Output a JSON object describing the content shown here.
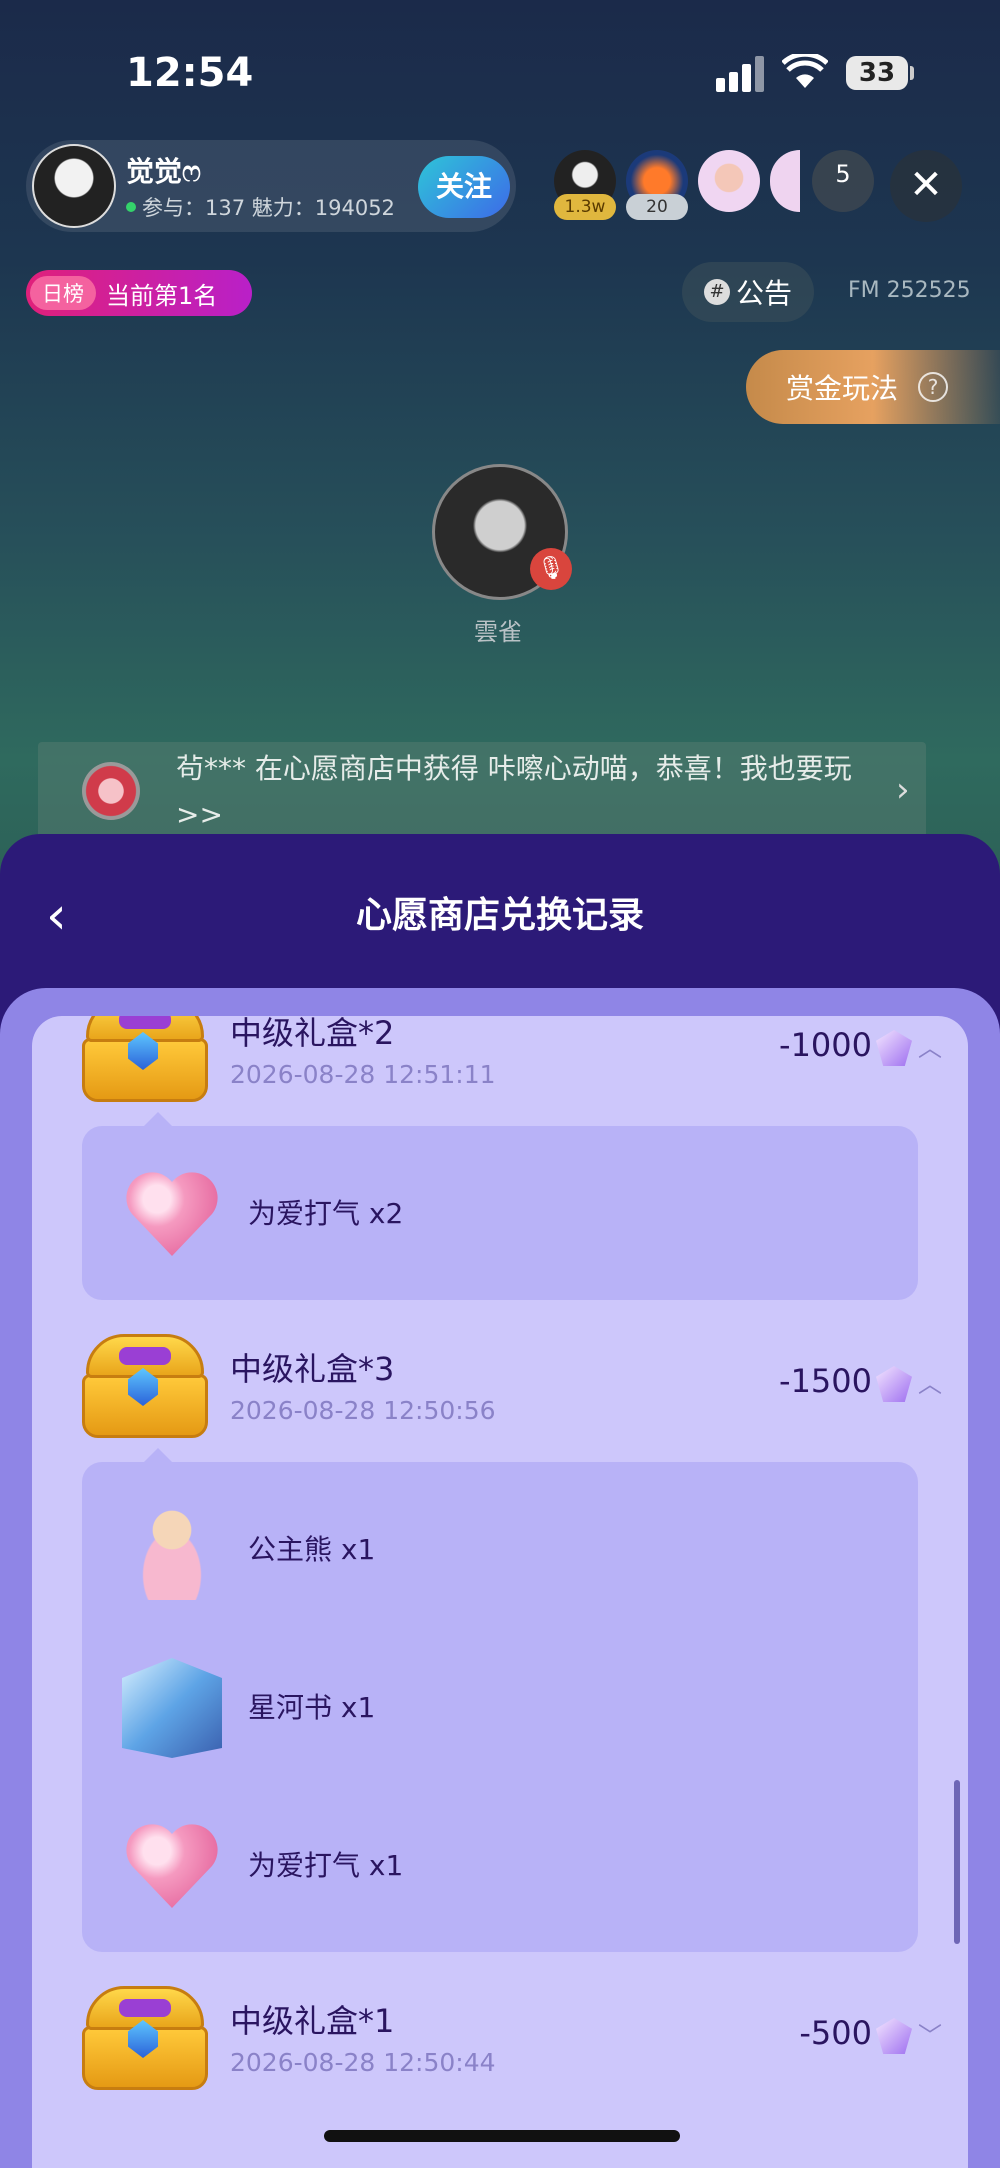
{
  "status_bar": {
    "time": "12:54",
    "battery": "33"
  },
  "host": {
    "name": "觉觉ෆ",
    "stats": "参与：137 魅力：194052",
    "follow_label": "关注"
  },
  "audience": {
    "badges": [
      "1.3w",
      "20"
    ],
    "more_count": "5"
  },
  "room": {
    "rank_tag": "日榜",
    "rank_text": "当前第1名",
    "notice_label": "公告",
    "fm": "FM 252525",
    "bounty_label": "赏金玩法",
    "mic_user": "雲雀"
  },
  "broadcast": {
    "text": "茍*** 在心愿商店中获得 咔嚓心动喵，恭喜！我也要玩 >>"
  },
  "sheet": {
    "title": "心愿商店兑换记录",
    "records": [
      {
        "title": "中级礼盒*2",
        "date": "2026-08-28 12:51:11",
        "amount": "-1000",
        "expanded": true,
        "items": [
          {
            "name": "为爱打气 x2",
            "icon": "heart-wand-icon"
          }
        ]
      },
      {
        "title": "中级礼盒*3",
        "date": "2026-08-28 12:50:56",
        "amount": "-1500",
        "expanded": true,
        "items": [
          {
            "name": "公主熊 x1",
            "icon": "princess-bear-icon"
          },
          {
            "name": "星河书 x1",
            "icon": "galaxy-book-icon"
          },
          {
            "name": "为爱打气 x1",
            "icon": "heart-wand-icon"
          }
        ]
      },
      {
        "title": "中级礼盒*1",
        "date": "2026-08-28 12:50:44",
        "amount": "-500",
        "expanded": false,
        "items": []
      }
    ]
  }
}
